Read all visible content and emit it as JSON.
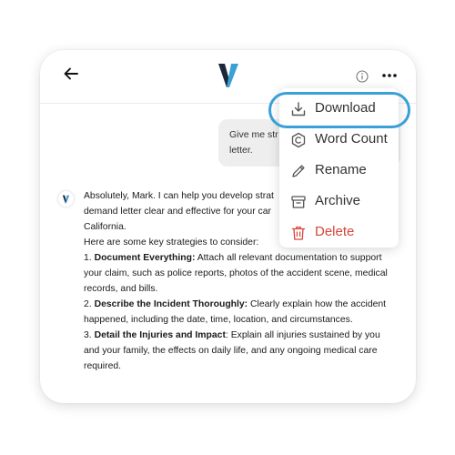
{
  "header": {
    "back_icon": "arrow-left-icon",
    "logo_icon": "brand-v-logo",
    "info_icon": "info-circle-icon",
    "more_icon": "more-horizontal-icon"
  },
  "chat": {
    "user_message_line1": "Give me str",
    "user_message_line2": "letter.",
    "ai_intro_1": "Absolutely, Mark. I can help you develop strat",
    "ai_intro_2": "demand letter clear and effective for your car",
    "ai_intro_3": "California.",
    "ai_intro_4": "Here are some key strategies to consider:",
    "strategies": [
      {
        "num": "1. ",
        "title": "Document Everything:",
        "body": " Attach all relevant documentation to support your claim, such as police reports, photos of the accident scene, medical records, and bills."
      },
      {
        "num": "2. ",
        "title": "Describe the Incident Thoroughly:",
        "body": " Clearly explain how the accident happened, including the date, time, location, and circumstances."
      },
      {
        "num": "3. ",
        "title": "Detail the Injuries and Impact",
        "body": ": Explain all injuries sustained by you and your family, the effects on daily life, and any ongoing medical care required."
      }
    ]
  },
  "menu": {
    "items": [
      {
        "label": "Download",
        "icon": "download-icon"
      },
      {
        "label": "Word Count",
        "icon": "copyright-c-icon"
      },
      {
        "label": "Rename",
        "icon": "pencil-icon"
      },
      {
        "label": "Archive",
        "icon": "archive-box-icon"
      },
      {
        "label": "Delete",
        "icon": "trash-icon"
      }
    ]
  },
  "colors": {
    "accent": "#3aa0d8",
    "danger": "#d5453b",
    "logo_dark": "#1b2a3a",
    "logo_light": "#3aa0d8"
  }
}
